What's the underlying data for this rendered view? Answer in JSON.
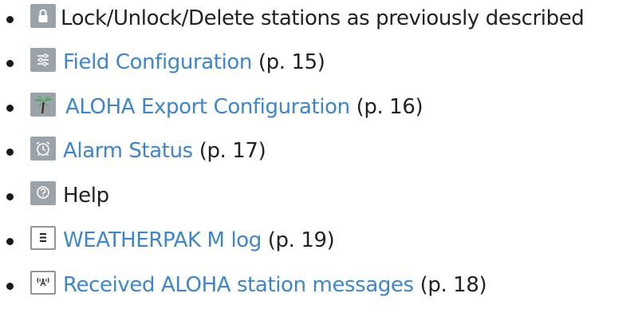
{
  "items": [
    {
      "icon": "lock-icon",
      "link_text": "",
      "plain_text": "Lock/Unlock/Delete stations as previously described",
      "page_ref": ""
    },
    {
      "icon": "sliders-icon",
      "link_text": "Field Configuration",
      "plain_text": "",
      "page_ref": "(p. 15)"
    },
    {
      "icon": "palm-tree-icon",
      "link_text": "ALOHA Export Configuration",
      "plain_text": "",
      "page_ref": "(p. 16)"
    },
    {
      "icon": "alarm-clock-icon",
      "link_text": "Alarm Status",
      "plain_text": "",
      "page_ref": "(p. 17)"
    },
    {
      "icon": "help-icon",
      "link_text": "",
      "plain_text": "Help",
      "page_ref": ""
    },
    {
      "icon": "log-list-icon",
      "link_text": "WEATHERPAK M log",
      "plain_text": "",
      "page_ref": "(p. 19)"
    },
    {
      "icon": "antenna-icon",
      "link_text": "Received ALOHA station messages",
      "plain_text": "",
      "page_ref": "(p. 18)"
    }
  ],
  "colors": {
    "link": "#3e86c9",
    "text": "#222222",
    "icon_grey": "#9aa3aa"
  }
}
